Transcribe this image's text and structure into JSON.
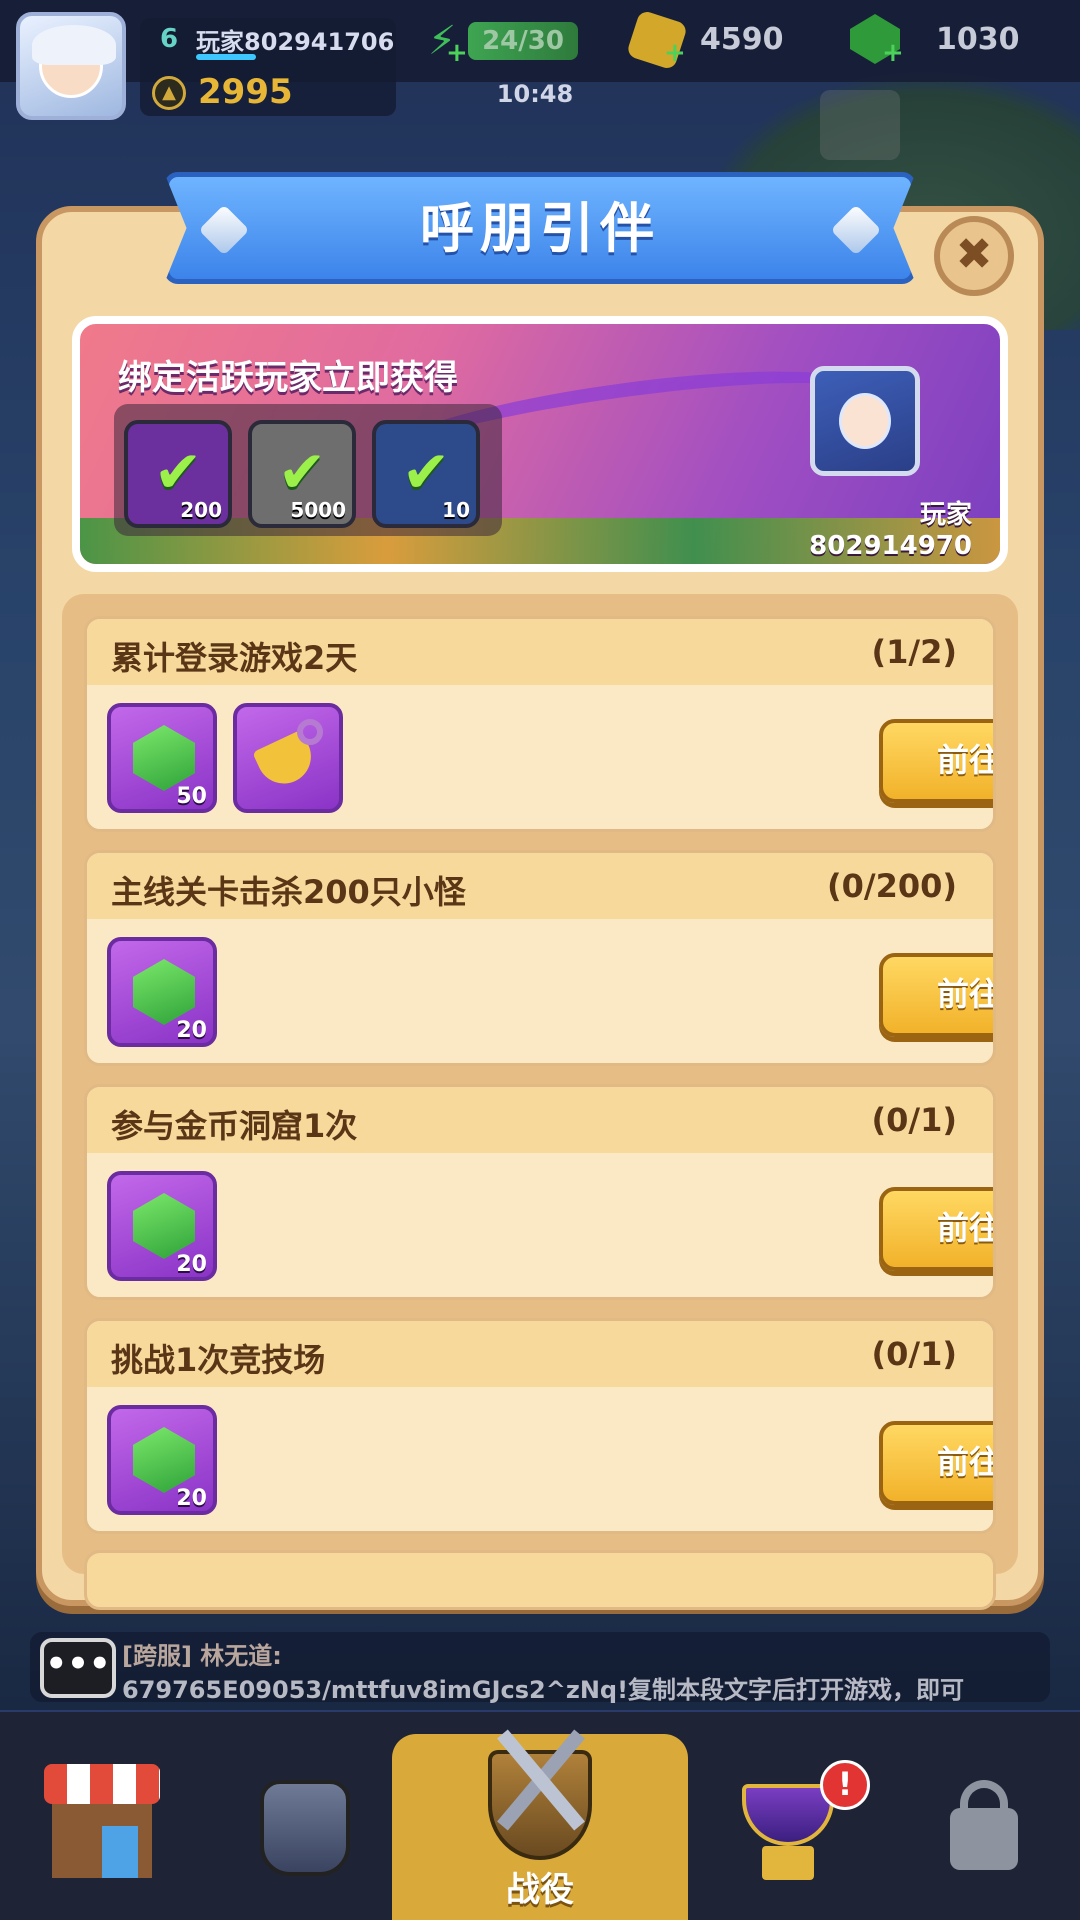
{
  "hud": {
    "level": "6",
    "player_name": "玩家802941706",
    "power": "2995",
    "stamina": "24/30",
    "time": "10:48",
    "coins": "4590",
    "gems": "1030"
  },
  "panel": {
    "title": "呼朋引伴",
    "close_icon": "close-icon"
  },
  "banner": {
    "title": "绑定活跃玩家立即获得",
    "items": [
      {
        "icon": "gem-icon",
        "count": "200",
        "claimed": true,
        "color": "#6b2f9e"
      },
      {
        "icon": "coin-icon",
        "count": "5000",
        "claimed": true,
        "color": "#6e6e6e"
      },
      {
        "icon": "scroll-icon",
        "count": "10",
        "claimed": true,
        "color": "#2d4a8a"
      }
    ],
    "friend_name": "玩家802914970"
  },
  "tasks": [
    {
      "title": "累计登录游戏2天",
      "progress": "(1/2)",
      "rewards": [
        {
          "icon": "gem-icon",
          "count": "50"
        },
        {
          "icon": "shovel-icon",
          "count": ""
        }
      ],
      "button": "前往"
    },
    {
      "title": "主线关卡击杀200只小怪",
      "progress": "(0/200)",
      "rewards": [
        {
          "icon": "gem-icon",
          "count": "20"
        }
      ],
      "button": "前往"
    },
    {
      "title": "参与金币洞窟1次",
      "progress": "(0/1)",
      "rewards": [
        {
          "icon": "gem-icon",
          "count": "20"
        }
      ],
      "button": "前往"
    },
    {
      "title": "挑战1次竞技场",
      "progress": "(0/1)",
      "rewards": [
        {
          "icon": "gem-icon",
          "count": "20"
        }
      ],
      "button": "前往"
    }
  ],
  "chat": {
    "sender": "[跨服] 林无道:",
    "message": "679765E09053/mttfuv8imGJcs2^zNq!复制本段文字后打开游戏，即可"
  },
  "nav": {
    "battle_label": "战役",
    "alert": "!"
  },
  "colors": {
    "accent_blue": "#3c84ea",
    "button_gold": "#f2b22a",
    "panel_bg": "#f3d7a4",
    "reward_purple": "#8a33c6"
  }
}
